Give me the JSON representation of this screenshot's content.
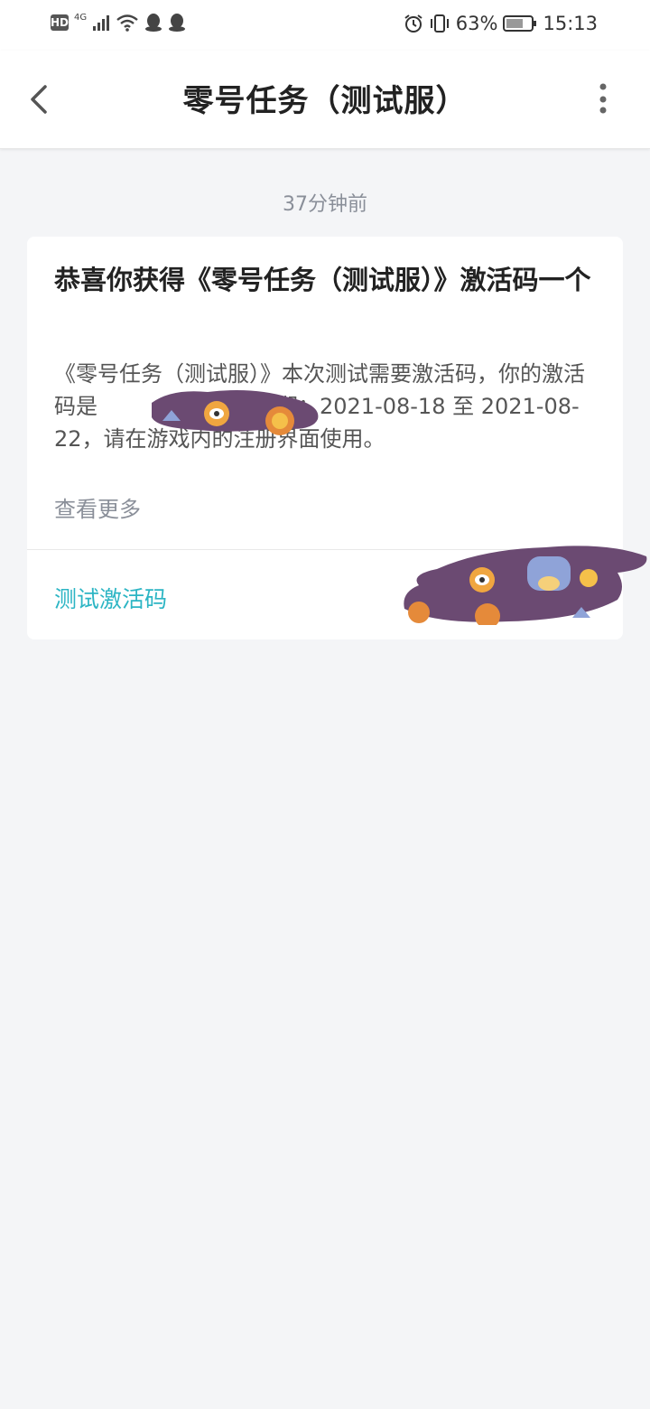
{
  "status_bar": {
    "hd": "HD",
    "network": "4G",
    "battery_percent": "63%",
    "time": "15:13"
  },
  "header": {
    "title": "零号任务（测试服）",
    "back_icon": "chevron-left-icon",
    "more_icon": "more-vertical-icon"
  },
  "message": {
    "timestamp": "37分钟前",
    "title": "恭喜你获得《零号任务（测试服）》激活码一个",
    "body_before_code": "《零号任务（测试服）》本次测试需要激活码，你的激活码是",
    "body_after_code": "有效期：2021-08-18 至 2021-08-22，请在游戏内的注册界面使用。",
    "see_more": "查看更多",
    "action_label": "测试激活码"
  },
  "colors": {
    "accent": "#2cb5c4",
    "redaction": "#6b4a72"
  }
}
